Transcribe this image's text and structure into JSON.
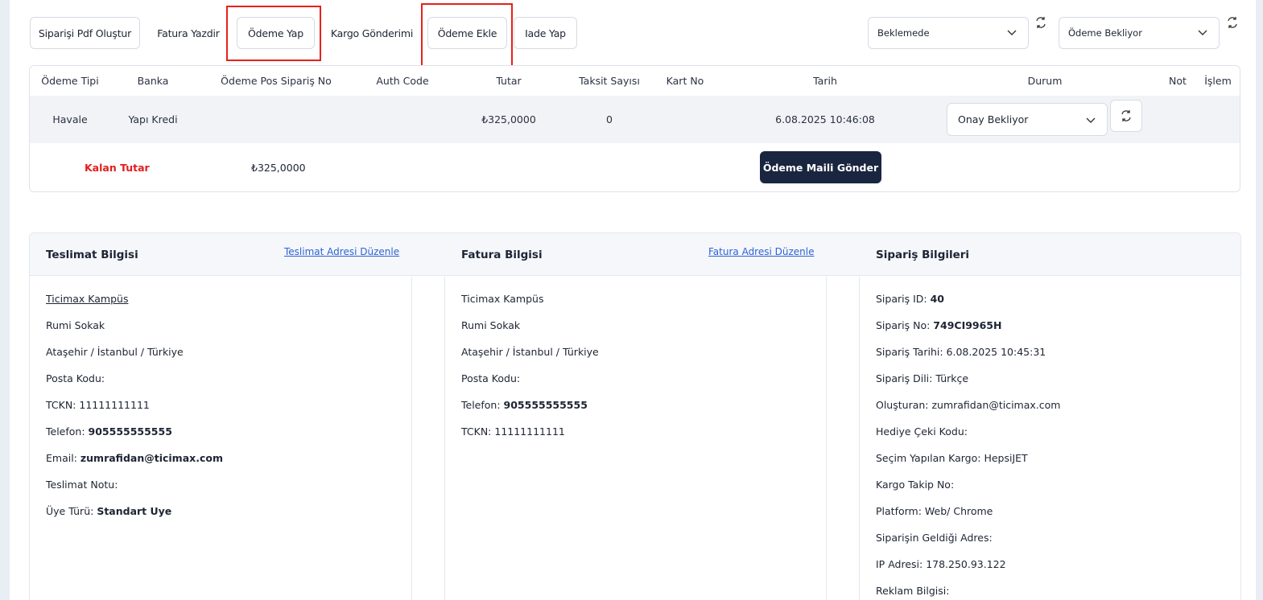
{
  "toolbar": {
    "pdf": "Siparişi Pdf Oluştur",
    "fatura_yazdir": "Fatura Yazdir",
    "odeme_yap": "Ödeme Yap",
    "kargo": "Kargo Gönderimi",
    "odeme_ekle": "Ödeme Ekle",
    "iade": "Iade Yap",
    "status_select": "Beklemede",
    "payment_status_select": "Ödeme Bekliyor"
  },
  "payments": {
    "headers": [
      "Ödeme Tipi",
      "Banka",
      "Ödeme Pos Sipariş No",
      "Auth Code",
      "Tutar",
      "Taksit Sayısı",
      "Kart No",
      "Tarih",
      "Durum",
      "Not",
      "İşlem"
    ],
    "row": {
      "tip": "Havale",
      "banka": "Yapı Kredi",
      "tutar": "₺325,0000",
      "taksit": "0",
      "tarih": "6.08.2025 10:46:08",
      "durum": "Onay Bekliyor"
    },
    "kalan_label": "Kalan Tutar",
    "kalan_value": "₺325,0000",
    "mail_button": "Ödeme Maili Gönder"
  },
  "teslimat": {
    "title": "Teslimat Bilgisi",
    "edit_link": "Teslimat Adresi Düzenle",
    "name": "Ticimax Kampüs",
    "street": "Rumi Sokak",
    "city": "Ataşehir / İstanbul / Türkiye",
    "posta_label": "Posta Kodu:",
    "tckn": "TCKN: 11111111111",
    "telefon_label": "Telefon: ",
    "telefon": "905555555555",
    "email_label": "Email: ",
    "email": "zumrafidan@ticimax.com",
    "not_label": "Teslimat Notu:",
    "uye_label": "Üye Türü: ",
    "uye": "Standart Uye"
  },
  "fatura": {
    "title": "Fatura Bilgisi",
    "edit_link": "Fatura Adresi Düzenle",
    "name": "Ticimax Kampüs",
    "street": "Rumi Sokak",
    "city": "Ataşehir / İstanbul / Türkiye",
    "posta_label": "Posta Kodu:",
    "telefon_label": "Telefon: ",
    "telefon": "905555555555",
    "tckn": "TCKN: 11111111111"
  },
  "siparis": {
    "title": "Sipariş Bilgileri",
    "id_label": "Sipariş ID: ",
    "id": "40",
    "no_label": "Sipariş No: ",
    "no": "749CI9965H",
    "tarih": "Sipariş Tarihi: 6.08.2025 10:45:31",
    "dil": "Sipariş Dili: Türkçe",
    "olusturan": "Oluşturan: zumrafidan@ticimax.com",
    "hediye": "Hediye Çeki Kodu:",
    "kargo": "Seçim Yapılan Kargo: HepsiJET",
    "takip": "Kargo Takip No:",
    "platform": "Platform: Web/ Chrome",
    "geldigi": "Siparişin Geldiği Adres:",
    "ip": "IP Adresi: 178.250.93.122",
    "reklam": "Reklam Bilgisi:"
  }
}
